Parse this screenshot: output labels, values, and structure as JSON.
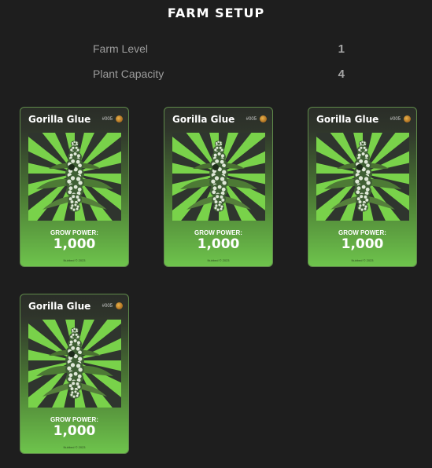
{
  "header": {
    "title": "FARM SETUP"
  },
  "stats": [
    {
      "label": "Farm Level",
      "value": "1"
    },
    {
      "label": "Plant Capacity",
      "value": "4"
    }
  ],
  "cards": [
    {
      "name": "Gorilla Glue",
      "number": "#005",
      "grow_power_label": "GROW POWER:",
      "grow_power": "1,000",
      "footer": "Nubbed © 2023",
      "badge_icon": "strain-badge-icon"
    },
    {
      "name": "Gorilla Glue",
      "number": "#005",
      "grow_power_label": "GROW POWER:",
      "grow_power": "1,000",
      "footer": "Nubbed © 2023",
      "badge_icon": "strain-badge-icon"
    },
    {
      "name": "Gorilla Glue",
      "number": "#005",
      "grow_power_label": "GROW POWER:",
      "grow_power": "1,000",
      "footer": "Nubbed © 2023",
      "badge_icon": "strain-badge-icon"
    },
    {
      "name": "Gorilla Glue",
      "number": "#005",
      "grow_power_label": "GROW POWER:",
      "grow_power": "1,000",
      "footer": "Nubbed © 2023",
      "badge_icon": "strain-badge-icon"
    }
  ],
  "colors": {
    "background": "#1e1e1e",
    "card_green": "#6ec44c",
    "ray_green": "#79d24a"
  }
}
